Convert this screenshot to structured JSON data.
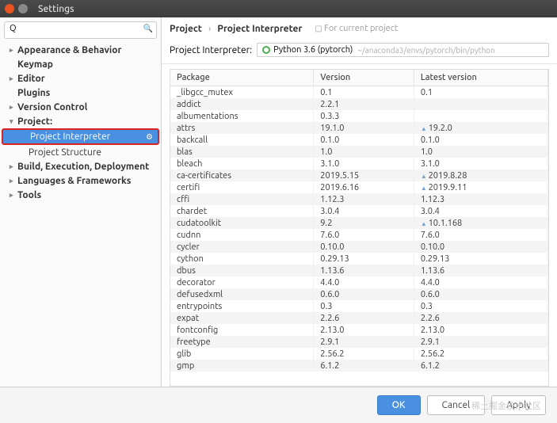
{
  "window": {
    "title": "Settings"
  },
  "search": {
    "placeholder": ""
  },
  "sidebar": {
    "items": [
      {
        "label": "Appearance & Behavior",
        "caret": true,
        "bold": true
      },
      {
        "label": "Keymap",
        "caret": false,
        "bold": true
      },
      {
        "label": "Editor",
        "caret": true,
        "bold": true
      },
      {
        "label": "Plugins",
        "caret": false,
        "bold": true
      },
      {
        "label": "Version Control",
        "caret": true,
        "bold": true
      },
      {
        "label": "Project:",
        "caret": true,
        "bold": true,
        "expanded": true
      },
      {
        "label": "Project Interpreter",
        "caret": false,
        "bold": false,
        "child": true,
        "selected": true,
        "gear": true
      },
      {
        "label": "Project Structure",
        "caret": false,
        "bold": false,
        "child": true
      },
      {
        "label": "Build, Execution, Deployment",
        "caret": true,
        "bold": true
      },
      {
        "label": "Languages & Frameworks",
        "caret": true,
        "bold": true
      },
      {
        "label": "Tools",
        "caret": true,
        "bold": true
      }
    ]
  },
  "breadcrumb": {
    "root": "Project",
    "sep": "›",
    "leaf": "Project Interpreter",
    "for_text": "For current project"
  },
  "interpreter": {
    "label": "Project Interpreter:",
    "name": "Python 3.6 (pytorch)",
    "path": "~/anaconda3/envs/pytorch/bin/python"
  },
  "table": {
    "headers": [
      "Package",
      "Version",
      "Latest version"
    ],
    "rows": [
      {
        "p": "_libgcc_mutex",
        "v": "0.1",
        "l": "0.1",
        "u": false
      },
      {
        "p": "addict",
        "v": "2.2.1",
        "l": "",
        "u": false
      },
      {
        "p": "albumentations",
        "v": "0.3.3",
        "l": "",
        "u": false
      },
      {
        "p": "attrs",
        "v": "19.1.0",
        "l": "19.2.0",
        "u": true
      },
      {
        "p": "backcall",
        "v": "0.1.0",
        "l": "0.1.0",
        "u": false
      },
      {
        "p": "blas",
        "v": "1.0",
        "l": "1.0",
        "u": false
      },
      {
        "p": "bleach",
        "v": "3.1.0",
        "l": "3.1.0",
        "u": false
      },
      {
        "p": "ca-certificates",
        "v": "2019.5.15",
        "l": "2019.8.28",
        "u": true
      },
      {
        "p": "certifi",
        "v": "2019.6.16",
        "l": "2019.9.11",
        "u": true
      },
      {
        "p": "cffi",
        "v": "1.12.3",
        "l": "1.12.3",
        "u": false
      },
      {
        "p": "chardet",
        "v": "3.0.4",
        "l": "3.0.4",
        "u": false
      },
      {
        "p": "cudatoolkit",
        "v": "9.2",
        "l": "10.1.168",
        "u": true
      },
      {
        "p": "cudnn",
        "v": "7.6.0",
        "l": "7.6.0",
        "u": false
      },
      {
        "p": "cycler",
        "v": "0.10.0",
        "l": "0.10.0",
        "u": false
      },
      {
        "p": "cython",
        "v": "0.29.13",
        "l": "0.29.13",
        "u": false
      },
      {
        "p": "dbus",
        "v": "1.13.6",
        "l": "1.13.6",
        "u": false
      },
      {
        "p": "decorator",
        "v": "4.4.0",
        "l": "4.4.0",
        "u": false
      },
      {
        "p": "defusedxml",
        "v": "0.6.0",
        "l": "0.6.0",
        "u": false
      },
      {
        "p": "entrypoints",
        "v": "0.3",
        "l": "0.3",
        "u": false
      },
      {
        "p": "expat",
        "v": "2.2.6",
        "l": "2.2.6",
        "u": false
      },
      {
        "p": "fontconfig",
        "v": "2.13.0",
        "l": "2.13.0",
        "u": false
      },
      {
        "p": "freetype",
        "v": "2.9.1",
        "l": "2.9.1",
        "u": false
      },
      {
        "p": "glib",
        "v": "2.56.2",
        "l": "2.56.2",
        "u": false
      },
      {
        "p": "gmp",
        "v": "6.1.2",
        "l": "6.1.2",
        "u": false
      }
    ]
  },
  "footer": {
    "ok": "OK",
    "cancel": "Cancel",
    "apply": "Apply"
  },
  "watermark": "稀土掘金技术社区"
}
